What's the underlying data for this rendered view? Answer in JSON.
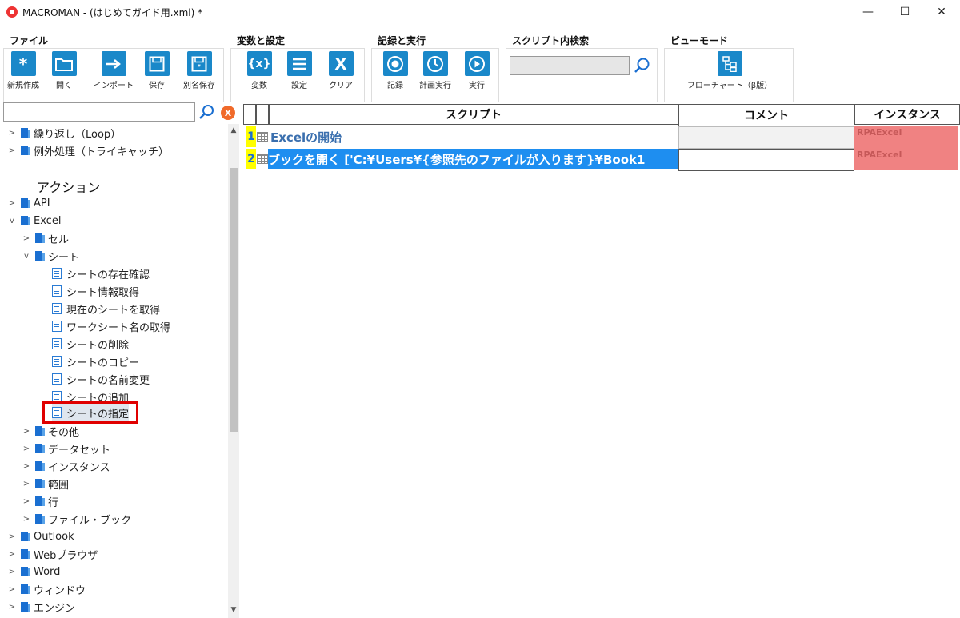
{
  "window": {
    "title": "MACROMAN - (はじめてガイド用.xml) *",
    "minimize": "—",
    "maximize": "☐",
    "close": "✕"
  },
  "ribbon": {
    "file": {
      "label": "ファイル",
      "buttons": [
        "新規作成",
        "開く",
        "インポート",
        "保存",
        "別名保存"
      ]
    },
    "vars": {
      "label": "変数と設定",
      "buttons": [
        "変数",
        "設定",
        "クリア"
      ]
    },
    "record": {
      "label": "記録と実行",
      "buttons": [
        "記録",
        "計画実行",
        "実行"
      ]
    },
    "search": {
      "label": "スクリプト内検索",
      "value": ""
    },
    "view": {
      "label": "ビューモード",
      "buttons": [
        "フローチャート（β版）"
      ]
    }
  },
  "left": {
    "search_value": "",
    "clear": "X",
    "section_title": "アクション",
    "items": [
      {
        "label": "繰り返し（Loop）"
      },
      {
        "label": "例外処理（トライキャッチ）"
      },
      {
        "label": "API"
      },
      {
        "label": "Excel"
      },
      {
        "label": "セル"
      },
      {
        "label": "シート"
      },
      {
        "label": "シートの存在確認"
      },
      {
        "label": "シート情報取得"
      },
      {
        "label": "現在のシートを取得"
      },
      {
        "label": "ワークシート名の取得"
      },
      {
        "label": "シートの削除"
      },
      {
        "label": "シートのコピー"
      },
      {
        "label": "シートの名前変更"
      },
      {
        "label": "シートの追加"
      },
      {
        "label": "シートの指定"
      },
      {
        "label": "その他"
      },
      {
        "label": "データセット"
      },
      {
        "label": "インスタンス"
      },
      {
        "label": "範囲"
      },
      {
        "label": "行"
      },
      {
        "label": "ファイル・ブック"
      },
      {
        "label": "Outlook"
      },
      {
        "label": "Webブラウザ"
      },
      {
        "label": "Word"
      },
      {
        "label": "ウィンドウ"
      },
      {
        "label": "エンジン"
      }
    ]
  },
  "grid": {
    "headers": {
      "script": "スクリプト",
      "comment": "コメント",
      "instance": "インスタンス"
    },
    "rows": [
      {
        "num": "1",
        "script": "Excelの開始",
        "comment": "",
        "instance": "RPAExcel"
      },
      {
        "num": "2",
        "script": "ブックを開く ['C:¥Users¥{参照先のファイルが入ります}¥Book1",
        "comment": "",
        "instance": "RPAExcel"
      }
    ]
  }
}
